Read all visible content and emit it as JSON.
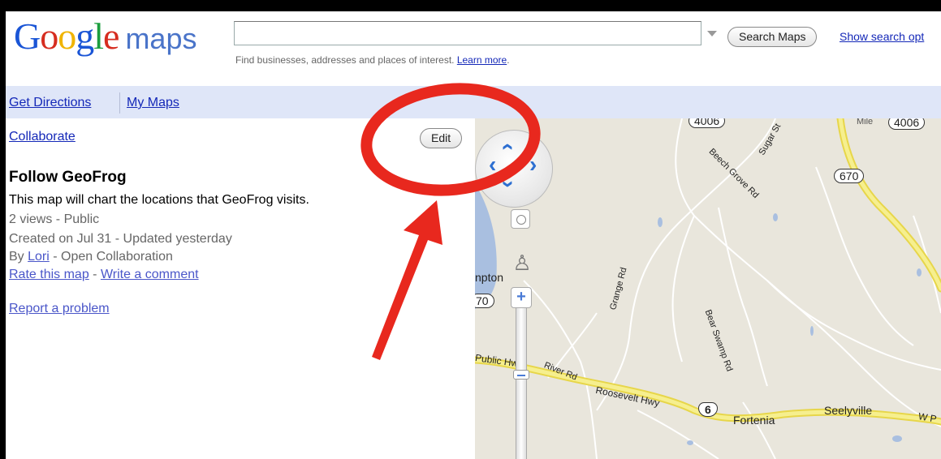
{
  "header": {
    "logo": {
      "G": "G",
      "o1": "o",
      "o2": "o",
      "g": "g",
      "l": "l",
      "e": "e",
      "maps": "maps"
    },
    "search_value": "",
    "search_button": "Search Maps",
    "search_options": "Show search opt",
    "hint_text": "Find businesses, addresses and places of interest. ",
    "hint_link": "Learn more",
    "hint_after": "."
  },
  "nav": {
    "get_directions": "Get Directions",
    "my_maps": "My Maps"
  },
  "panel": {
    "collaborate": "Collaborate",
    "edit_button": "Edit",
    "title": "Follow GeoFrog",
    "description": "This map will chart the locations that GeoFrog visits.",
    "views": "2 views - Public",
    "dates": "Created on Jul 31 - Updated yesterday",
    "by_prefix": "By ",
    "author": "Lori",
    "by_suffix": " - Open Collaboration",
    "rate": "Rate this map",
    "dash": " - ",
    "comment": "Write a comment",
    "report": "Report a problem"
  },
  "map": {
    "labels": {
      "route_4006_a": "4006",
      "route_4006_b": "4006",
      "mile": "Mile",
      "sugar_st": "Sugar St",
      "beech_grove": "Beech Grove Rd",
      "route_670_a": "670",
      "grange_rd": "Grange Rd",
      "npton": "npton",
      "route_670_b": "70",
      "bear_swamp": "Bear Swamp Rd",
      "public_hwy": "Public Hwy",
      "river_rd": "River Rd",
      "roosevelt": "Roosevelt Hwy",
      "route_6": "6",
      "fortenia": "Fortenia",
      "seelyville": "Seelyville",
      "w_p": "W P"
    }
  },
  "colors": {
    "annotation_red": "#e8281e",
    "link_blue": "#1428b8",
    "nav_bg": "#dfe6f8",
    "highway_yellow": "#f2e86a"
  }
}
